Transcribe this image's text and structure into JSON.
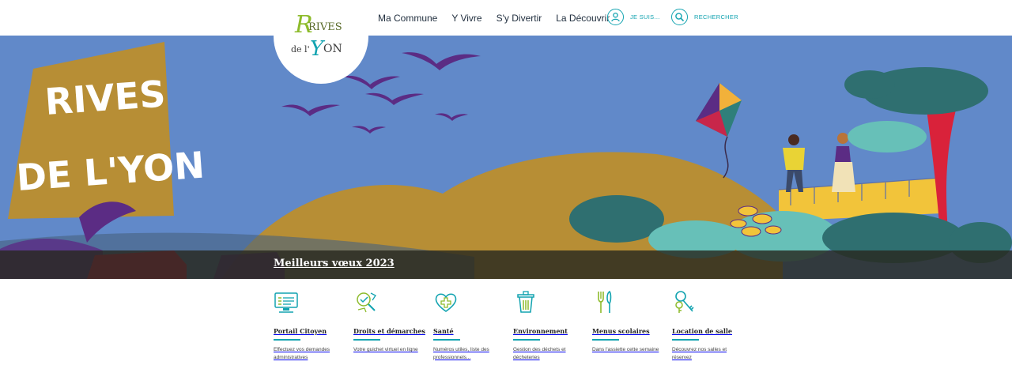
{
  "header": {
    "logo": {
      "line1": "RIVES",
      "line2": "de l'",
      "line3": "YON"
    },
    "nav": [
      "Ma Commune",
      "Y Vivre",
      "S'y Divertir",
      "La Découvrir"
    ],
    "account_label": "JE SUIS...",
    "search_label": "RECHERCHER"
  },
  "hero": {
    "banner_line1": "RIVES",
    "banner_line2": "DE L'YON",
    "caption": "Meilleurs vœux 2023"
  },
  "services": [
    {
      "title": "Portail Citoyen",
      "desc": "Effectuez vos demandes administratives",
      "icon": "computer-icon"
    },
    {
      "title": "Droits et démarches",
      "desc": "Votre guichet virtuel en ligne",
      "icon": "document-icon"
    },
    {
      "title": "Santé",
      "desc": "Numéros utiles, liste des professionnels...",
      "icon": "heart-cross-icon"
    },
    {
      "title": "Environnement",
      "desc": "Gestion des déchets et décheteries",
      "icon": "trash-icon"
    },
    {
      "title": "Menus scolaires",
      "desc": "Dans l'assiette cette semaine",
      "icon": "cutlery-icon"
    },
    {
      "title": "Location de salle",
      "desc": "Découvrez nos salles et réservez",
      "icon": "keys-icon"
    }
  ],
  "colors": {
    "accent": "#12a3b0",
    "logo_green": "#8dbb2b",
    "sky": "#6189c9",
    "ochre": "#b78e35"
  }
}
